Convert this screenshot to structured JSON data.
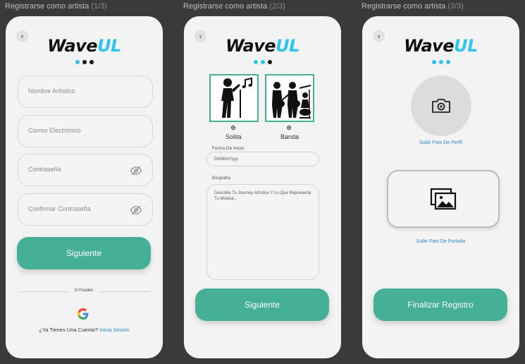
{
  "frames": [
    {
      "title": "Registrarse como artista",
      "step": "(1/3)"
    },
    {
      "title": "Registrarse como artista",
      "step": "(2/3)"
    },
    {
      "title": "Registrarse como artista",
      "step": "(3/3)"
    }
  ],
  "logo": {
    "part1": "Wave",
    "part2": "UL"
  },
  "icons": {
    "back": "back-chevron-icon",
    "eye_off": "eye-off-icon",
    "google": "google-icon",
    "camera": "camera-icon",
    "images": "image-gallery-icon"
  },
  "colors": {
    "accent": "#45b095",
    "logo_accent": "#2ec4f1",
    "link": "#2a86d6"
  },
  "step1": {
    "artist_name_placeholder": "Nombre Artístico",
    "email_placeholder": "Correo Electrónico",
    "password_placeholder": "Contraseña",
    "confirm_password_placeholder": "Confirmar Contraseña",
    "next_label": "Siguiente",
    "divider_text": "O Puedes",
    "have_account_text": "¿Ya Tienes Una Cuenta?",
    "login_link": "Inicia Sesión"
  },
  "step2": {
    "option_solo_label": "Solita",
    "option_band_label": "Banda",
    "start_date_label": "Fecha De Inicio",
    "start_date_placeholder": "Dd/Mm/Yyyy",
    "bio_label": "Biografía",
    "bio_placeholder": "Describe Tu Journey Artístico Y Lo Que Representa Tu Música...",
    "next_label": "Siguiente"
  },
  "step3": {
    "profile_photo_label": "Subir Foto De Perfil",
    "cover_photo_label": "Subir Foto De Portada",
    "finish_label": "Finalizar Registro"
  }
}
